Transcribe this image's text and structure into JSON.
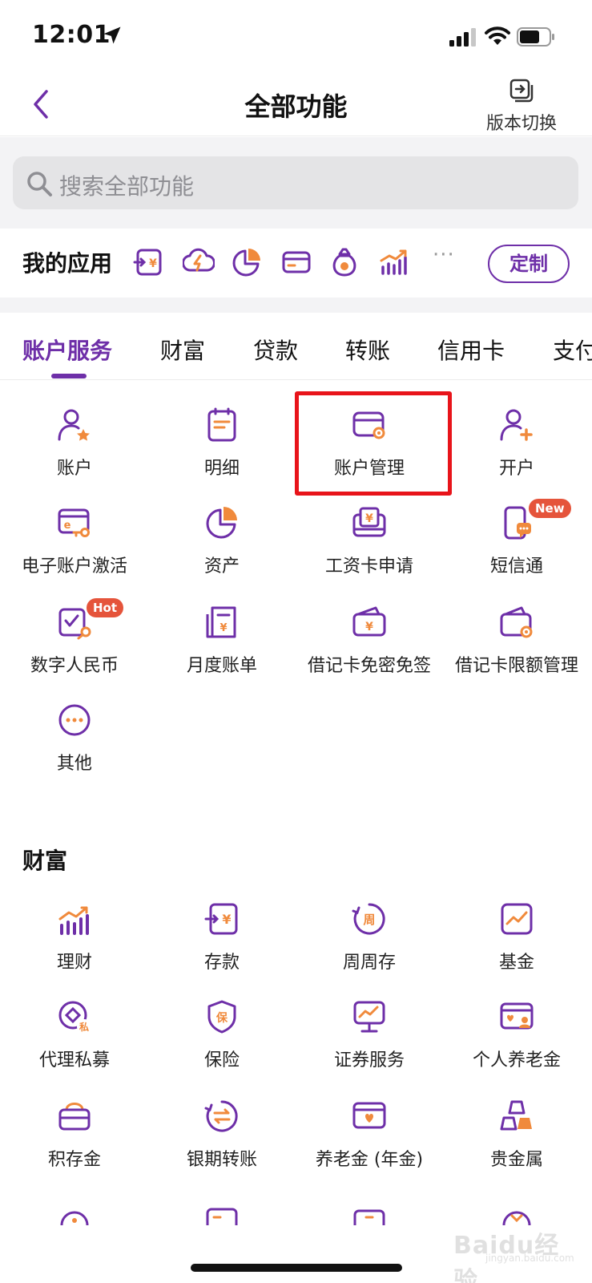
{
  "status_bar": {
    "time": "12:01"
  },
  "nav": {
    "title": "全部功能",
    "version_switch": "版本切换"
  },
  "search": {
    "placeholder": "搜索全部功能"
  },
  "my_apps": {
    "title": "我的应用",
    "icons": [
      "deposit-icon",
      "bolt-cloud-icon",
      "pie-chart-icon",
      "card-icon",
      "money-bag-icon",
      "growth-chart-icon"
    ],
    "more": "···",
    "customize": "定制"
  },
  "tabs": [
    {
      "label": "账户服务",
      "active": true
    },
    {
      "label": "财富",
      "active": false
    },
    {
      "label": "贷款",
      "active": false
    },
    {
      "label": "转账",
      "active": false
    },
    {
      "label": "信用卡",
      "active": false
    },
    {
      "label": "支付",
      "active": false
    }
  ],
  "account_services": {
    "items": [
      {
        "label": "账户",
        "icon": "user-star-icon"
      },
      {
        "label": "明细",
        "icon": "document-list-icon"
      },
      {
        "label": "账户管理",
        "icon": "card-gear-icon"
      },
      {
        "label": "开户",
        "icon": "user-add-icon"
      },
      {
        "label": "电子账户激活",
        "icon": "e-card-key-icon"
      },
      {
        "label": "资产",
        "icon": "pie-chart-icon"
      },
      {
        "label": "工资卡申请",
        "icon": "salary-card-icon"
      },
      {
        "label": "短信通",
        "icon": "phone-message-icon",
        "badge": "New"
      },
      {
        "label": "数字人民币",
        "icon": "digital-rmb-icon",
        "badge": "Hot"
      },
      {
        "label": "月度账单",
        "icon": "monthly-bill-icon"
      },
      {
        "label": "借记卡免密免签",
        "icon": "debit-card-yuan-icon"
      },
      {
        "label": "借记卡限额管理",
        "icon": "wallet-gear-icon"
      },
      {
        "label": "其他",
        "icon": "more-circle-icon"
      }
    ]
  },
  "wealth": {
    "title": "财富",
    "items": [
      {
        "label": "理财",
        "icon": "growth-chart-icon"
      },
      {
        "label": "存款",
        "icon": "deposit-icon"
      },
      {
        "label": "周周存",
        "icon": "weekly-circle-icon",
        "glyph": "周"
      },
      {
        "label": "基金",
        "icon": "fund-chart-icon"
      },
      {
        "label": "代理私募",
        "icon": "private-equity-icon",
        "glyph": "私"
      },
      {
        "label": "保险",
        "icon": "insurance-shield-icon",
        "glyph": "保"
      },
      {
        "label": "证券服务",
        "icon": "securities-monitor-icon"
      },
      {
        "label": "个人养老金",
        "icon": "pension-card-icon"
      },
      {
        "label": "积存金",
        "icon": "gold-basket-icon"
      },
      {
        "label": "银期转账",
        "icon": "exchange-circle-icon"
      },
      {
        "label": "养老金 (年金)",
        "icon": "annuity-card-icon"
      },
      {
        "label": "贵金属",
        "icon": "gold-bars-icon"
      }
    ]
  },
  "watermark": {
    "brand": "Baidu经验",
    "sub": "jingyan.baidu.com"
  },
  "colors": {
    "primary": "#6e2fa8",
    "accent": "#f08a3c",
    "highlight": "#e8141a",
    "badge": "#e5543b"
  }
}
